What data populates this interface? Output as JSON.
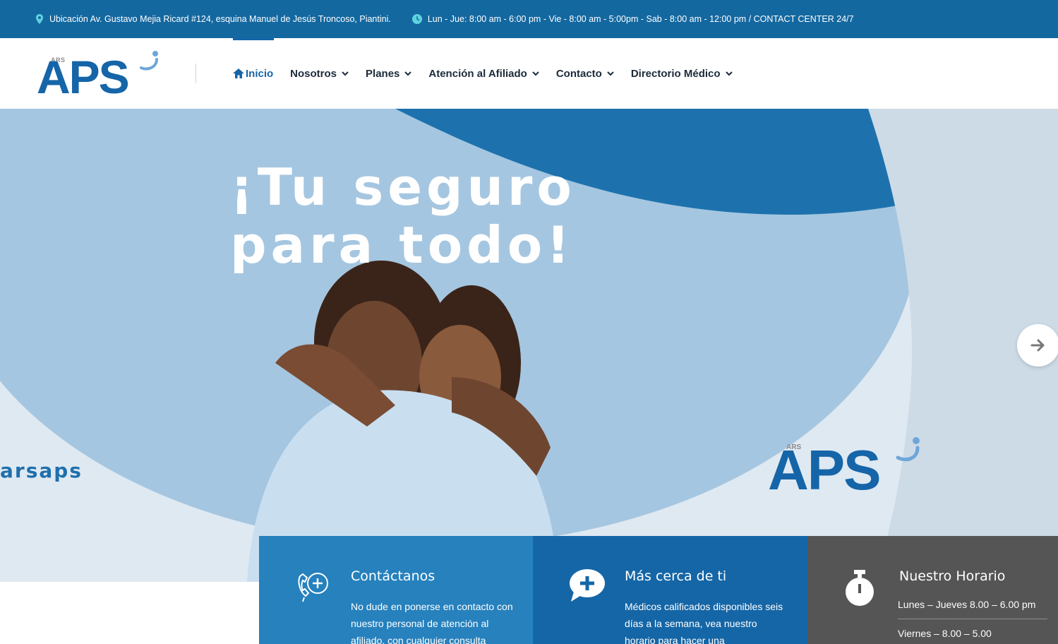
{
  "topbar": {
    "location_icon": "map-pin-icon",
    "location": "Ubicación Av. Gustavo Mejia Ricard #124, esquina Manuel de Jesús Troncoso, Piantini.",
    "hours_icon": "clock-icon",
    "hours": "Lun - Jue: 8:00 am - 6:00 pm - Vie - 8:00 am - 5:00pm - Sab - 8:00 am - 12:00 pm / CONTACT CENTER 24/7"
  },
  "header": {
    "logo": {
      "small": "ARS",
      "main": "APS"
    },
    "nav": [
      {
        "label": "Inicio",
        "active": true,
        "icon": "home-icon"
      },
      {
        "label": "Nosotros",
        "dropdown": true
      },
      {
        "label": "Planes",
        "dropdown": true
      },
      {
        "label": "Atención al Afiliado",
        "dropdown": true
      },
      {
        "label": "Contacto",
        "dropdown": true
      },
      {
        "label": "Directorio Médico",
        "dropdown": true
      }
    ]
  },
  "hero": {
    "headline_line1": "¡Tu seguro",
    "headline_line2": "para todo!",
    "handle": "arsaps",
    "logo": {
      "small": "ARS",
      "main": "APS"
    },
    "next_icon": "arrow-right-icon"
  },
  "cards": [
    {
      "icon": "phone-plus-icon",
      "title": "Contáctanos",
      "text": "No dude en ponerse en contacto con nuestro personal de atención al afiliado, con cualquier consulta"
    },
    {
      "icon": "chat-plus-icon",
      "title": "Más cerca de ti",
      "text": "Médicos calificados disponibles seis días a la semana, vea nuestro horario para hacer una"
    },
    {
      "icon": "stopwatch-icon",
      "title": "Nuestro Horario",
      "row1": "Lunes – Jueves 8.00 – 6.00 pm",
      "row2": "Viernes – 8.00 – 5.00"
    }
  ],
  "colors": {
    "primary": "#1468a0",
    "brand_blue": "#1565a8",
    "card_light": "#2681bd",
    "card_dark": "#1566a6",
    "card_gray": "#555555"
  }
}
